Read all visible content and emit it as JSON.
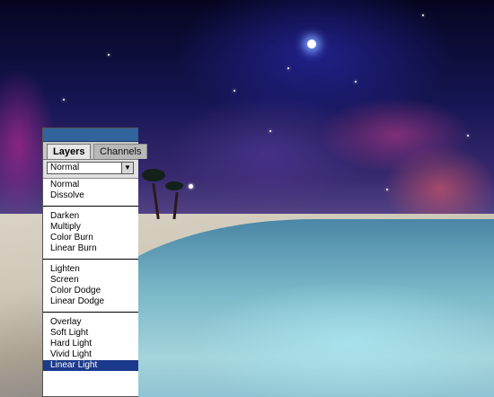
{
  "panel": {
    "tabs": [
      {
        "label": "Layers"
      },
      {
        "label": "Channels"
      }
    ],
    "blend_select_value": "Normal",
    "blend_modes": [
      {
        "label": "Normal"
      },
      {
        "label": "Dissolve"
      },
      {
        "label": "Darken"
      },
      {
        "label": "Multiply"
      },
      {
        "label": "Color Burn"
      },
      {
        "label": "Linear Burn"
      },
      {
        "label": "Lighten"
      },
      {
        "label": "Screen"
      },
      {
        "label": "Color Dodge"
      },
      {
        "label": "Linear Dodge"
      },
      {
        "label": "Overlay"
      },
      {
        "label": "Soft Light"
      },
      {
        "label": "Hard Light"
      },
      {
        "label": "Vivid Light"
      },
      {
        "label": "Linear Light"
      }
    ],
    "selected_mode": "Linear Light"
  },
  "colors": {
    "selection_highlight": "#1c3a8c",
    "titlebar": "#31639c"
  }
}
